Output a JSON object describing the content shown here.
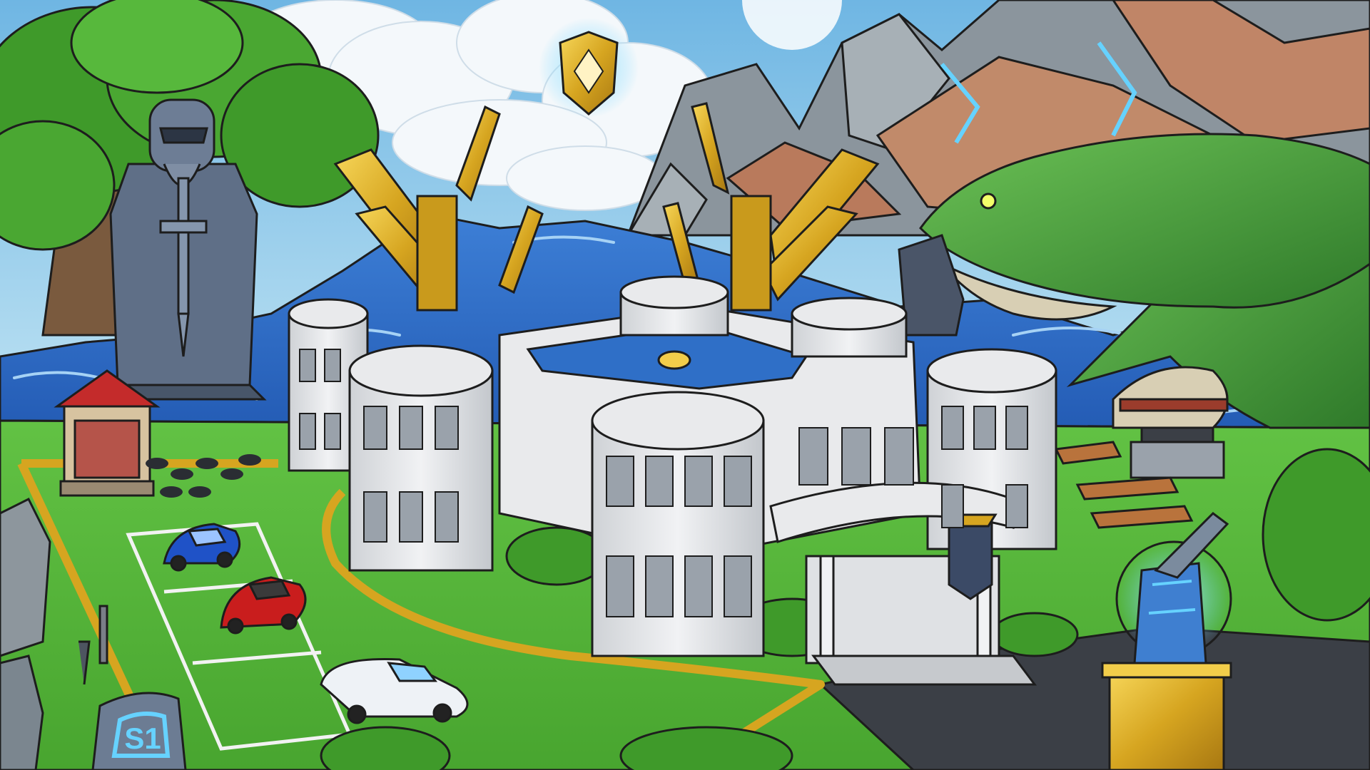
{
  "scene": {
    "rune_stone_glyph": "S1"
  },
  "colors": {
    "sky_top": "#6fb6e3",
    "sky_bottom": "#bfe3f3",
    "cloud": "#f4f8fb",
    "mountain": "#7b868f",
    "mountain_light": "#a7b0b6",
    "cliff": "#b97a5c",
    "water": "#2f6fc7",
    "water_light": "#5ea3e6",
    "grass": "#58b83a",
    "grass_dark": "#3f9a2a",
    "gold": "#d6a520",
    "gold_light": "#f2cd4a",
    "mansion_wall": "#e9eaec",
    "mansion_shade": "#c6c9cd",
    "window": "#9aa2ab",
    "statue": "#5f6f87",
    "serpent": "#4a9a3e",
    "serpent_belly": "#d8cfb4",
    "car_blue": "#1f52c7",
    "car_red": "#c91d1d",
    "car_white": "#eef2f6",
    "road": "#3b3f46",
    "rune_glow": "#66d2ff"
  }
}
